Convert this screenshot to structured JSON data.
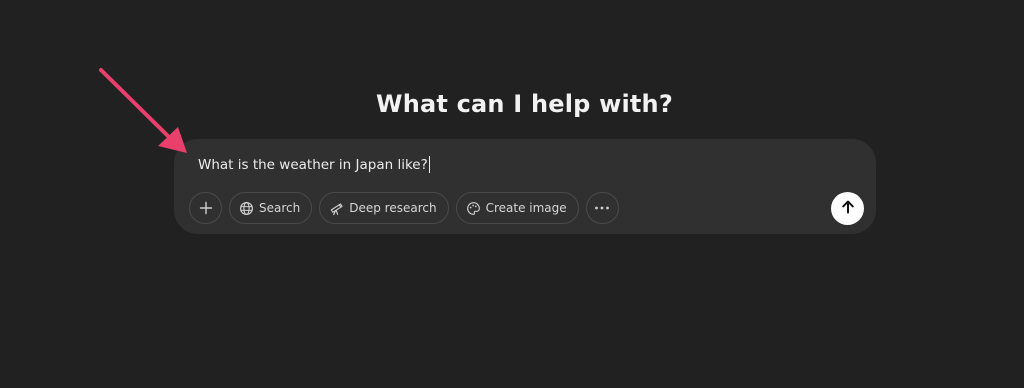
{
  "heading": "What can I help with?",
  "composer": {
    "input_value": "What is the weather in Japan like?",
    "tools": {
      "add_icon": "plus-icon",
      "search_label": "Search",
      "search_icon": "globe-icon",
      "deep_research_label": "Deep research",
      "deep_research_icon": "telescope-icon",
      "create_image_label": "Create image",
      "create_image_icon": "palette-icon",
      "more_icon": "more-horizontal-icon"
    },
    "send_icon": "arrow-up-icon"
  },
  "annotation": {
    "arrow_color": "#e8406a"
  },
  "colors": {
    "background": "#212121",
    "composer": "#303030",
    "send_button": "#ffffff"
  }
}
